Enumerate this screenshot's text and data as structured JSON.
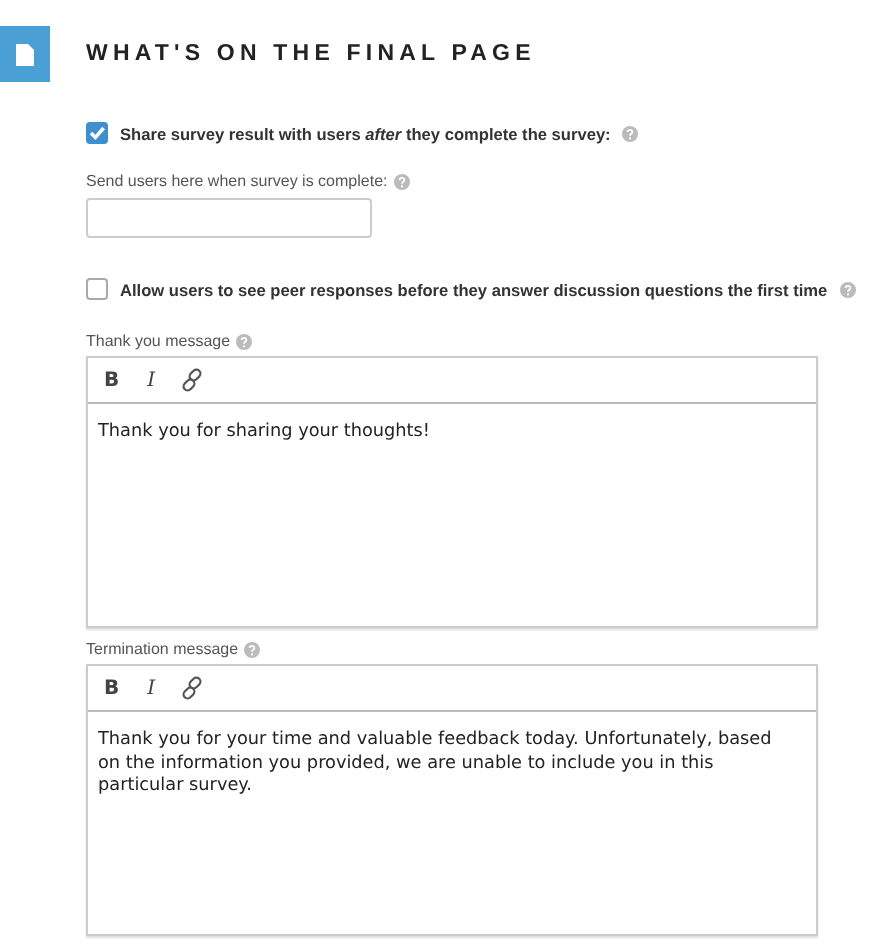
{
  "section": {
    "title": "WHAT'S ON THE FINAL PAGE"
  },
  "share_option": {
    "label": "Share survey result with users *after* they complete the survey:",
    "checked": true
  },
  "redirect_field": {
    "label": "Send users here when survey is complete:"
  },
  "peer_option": {
    "label": "Allow users to see peer responses before they answer discussion questions the first time",
    "checked": false
  },
  "editors": [
    {
      "label": "Thank you message",
      "toolbar": [
        "B",
        "I"
      ],
      "value": "Thank you for sharing your thoughts!"
    },
    {
      "label": "Termination message",
      "toolbar": [
        "B",
        "I"
      ],
      "value": "Thank you for your time and valuable feedback today. Unfortunately, based on the information you provided, we are unable to include you in this particular survey."
    }
  ]
}
